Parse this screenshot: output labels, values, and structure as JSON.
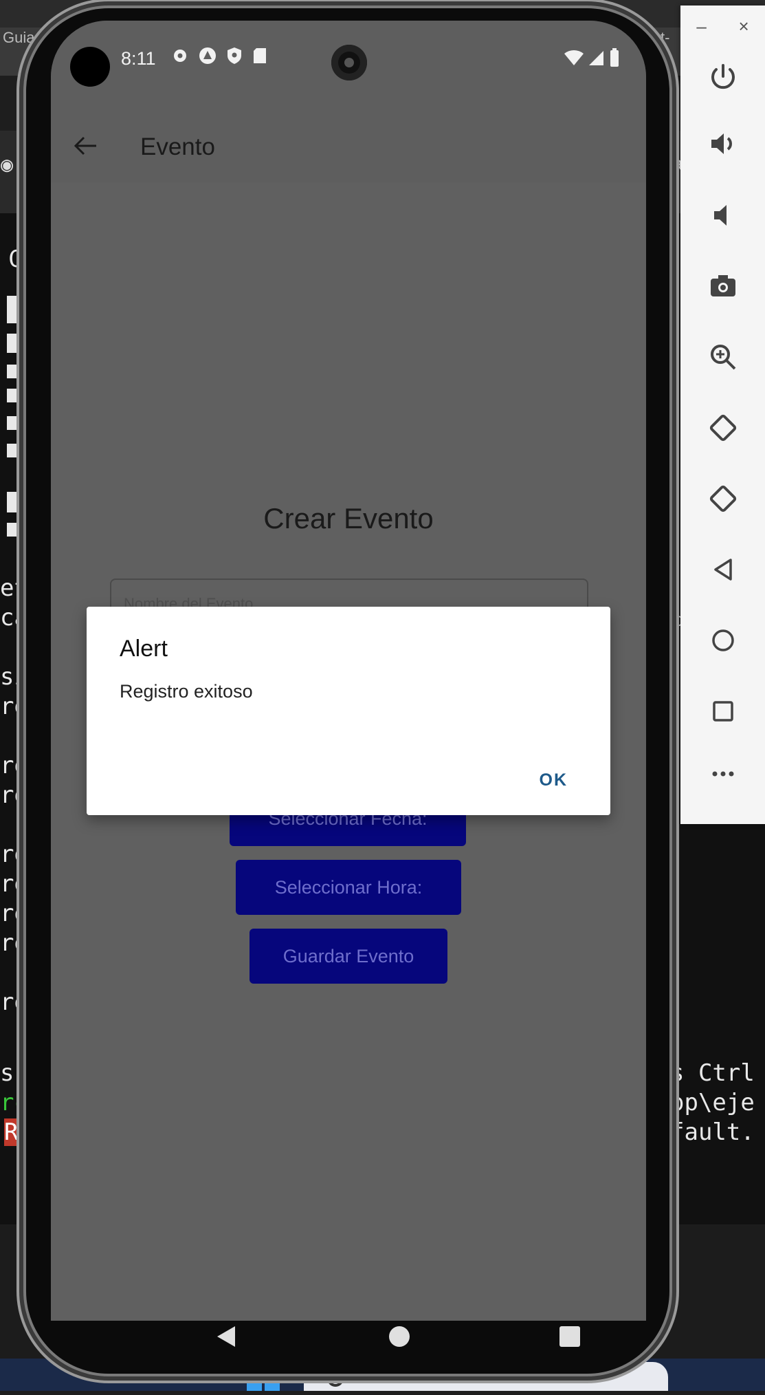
{
  "app": {
    "status_bar": {
      "time": "8:11"
    },
    "appbar": {
      "title": "Evento"
    },
    "form": {
      "heading": "Crear Evento",
      "name_placeholder": "Nombre del Evento",
      "select_date_label": "Seleccionar Fecha:",
      "select_time_label": "Seleccionar Hora:",
      "save_label": "Guardar Evento"
    },
    "dialog": {
      "title": "Alert",
      "message": "Registro exitoso",
      "ok_label": "OK"
    }
  },
  "background": {
    "browser_tab_left": "Guia",
    "browser_tab_right": "ct-",
    "terminal_left_chars": [
      "C",
      "et",
      "ca",
      "si",
      "re",
      "re",
      "re",
      "re",
      "re",
      "re",
      "re",
      "re",
      "s",
      "rc",
      "RC"
    ],
    "terminal_right_lines": [
      "s Ctrl",
      "op\\eje",
      "fault."
    ],
    "right_side_char": "ta",
    "right_side_char2": "d"
  },
  "emulator_toolbar": {
    "minimize": "–",
    "close": "×",
    "icons": [
      "power-icon",
      "volume-up-icon",
      "volume-down-icon",
      "screenshot-icon",
      "zoom-icon",
      "rotate-left-icon",
      "rotate-right-icon",
      "back-icon",
      "home-icon",
      "overview-icon",
      "more-icon"
    ]
  },
  "colors": {
    "dialog_ok": "#1e5a8a",
    "button_bg": "#06067c",
    "scrim_screen": "#606060"
  }
}
